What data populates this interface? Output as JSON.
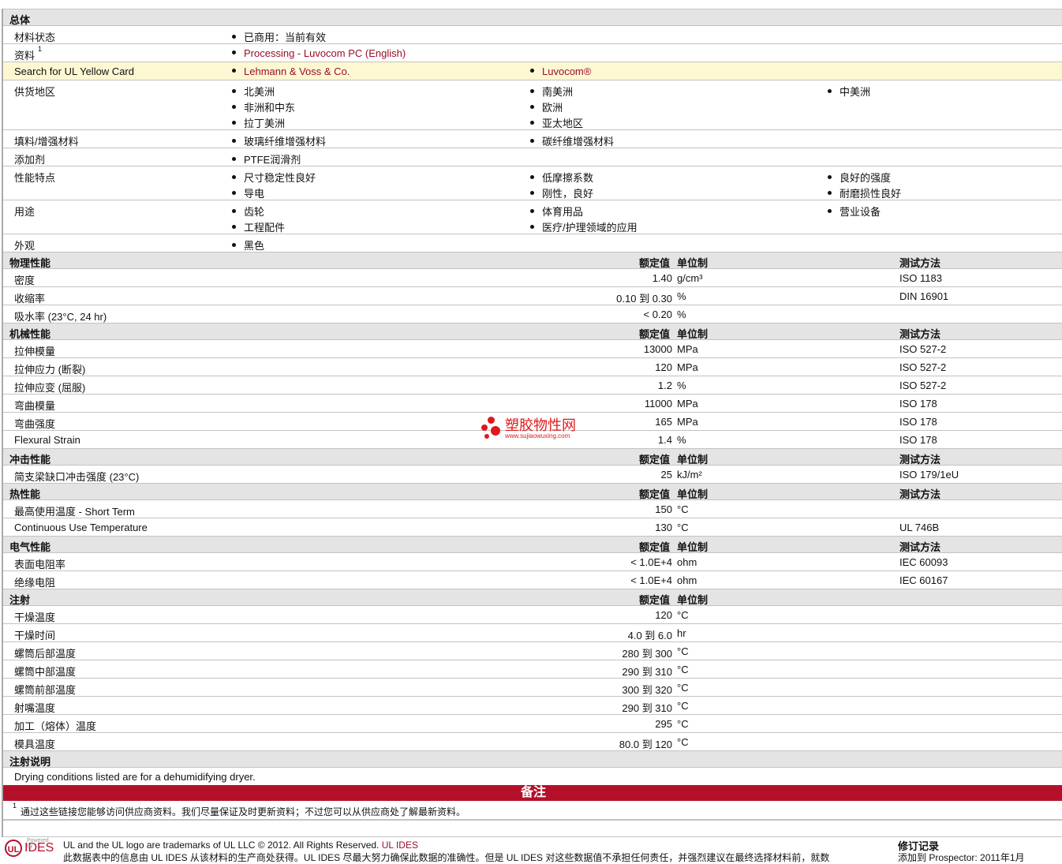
{
  "general": {
    "title": "总体",
    "rows": [
      {
        "label": "材料状态",
        "cols": [
          [
            "已商用：当前有效"
          ]
        ]
      },
      {
        "label": "资料",
        "sup": "1",
        "cols": [
          [
            "Processing - Luvocom PC (English)"
          ]
        ],
        "link": true
      },
      {
        "label": "Search for UL Yellow Card",
        "cols": [
          [
            "Lehmann & Voss & Co."
          ],
          [
            "Luvocom®"
          ]
        ],
        "link": true,
        "yellow": true
      },
      {
        "label": "供货地区",
        "cols": [
          [
            "北美洲",
            "非洲和中东",
            "拉丁美洲"
          ],
          [
            "南美洲",
            "欧洲",
            "亚太地区"
          ],
          [
            "中美洲"
          ]
        ]
      },
      {
        "label": "填料/增强材料",
        "cols": [
          [
            "玻璃纤维增强材料"
          ],
          [
            "碳纤维增强材料"
          ]
        ]
      },
      {
        "label": "添加剂",
        "cols": [
          [
            "PTFE润滑剂"
          ]
        ]
      },
      {
        "label": "性能特点",
        "cols": [
          [
            "尺寸稳定性良好",
            "导电"
          ],
          [
            "低摩擦系数",
            "刚性，良好"
          ],
          [
            "良好的强度",
            "耐磨损性良好"
          ]
        ]
      },
      {
        "label": "用途",
        "cols": [
          [
            "齿轮",
            "工程配件"
          ],
          [
            "体育用品",
            "医疗/护理领域的应用"
          ],
          [
            "营业设备"
          ]
        ]
      },
      {
        "label": "外观",
        "cols": [
          [
            "黑色"
          ]
        ]
      }
    ]
  },
  "headers": {
    "value": "额定值",
    "unit": "单位制",
    "method": "测试方法"
  },
  "sections": [
    {
      "title": "物理性能",
      "method": true,
      "rows": [
        [
          "密度",
          "1.40",
          "g/cm³",
          "ISO 1183"
        ],
        [
          "收缩率",
          "0.10 到  0.30",
          "%",
          "DIN 16901"
        ],
        [
          "吸水率  (23°C, 24 hr)",
          "< 0.20",
          "%",
          ""
        ]
      ]
    },
    {
      "title": "机械性能",
      "method": true,
      "rows": [
        [
          "拉伸模量",
          "13000",
          "MPa",
          "ISO 527-2"
        ],
        [
          "拉伸应力  (断裂)",
          "120",
          "MPa",
          "ISO 527-2"
        ],
        [
          "拉伸应变  (屈服)",
          "1.2",
          "%",
          "ISO 527-2"
        ],
        [
          "弯曲模量",
          "11000",
          "MPa",
          "ISO 178"
        ],
        [
          "弯曲强度",
          "165",
          "MPa",
          "ISO 178"
        ],
        [
          "Flexural Strain",
          "1.4",
          "%",
          "ISO 178"
        ]
      ]
    },
    {
      "title": "冲击性能",
      "method": true,
      "rows": [
        [
          "简支梁缺口冲击强度  (23°C)",
          "25",
          "kJ/m²",
          "ISO 179/1eU"
        ]
      ]
    },
    {
      "title": "热性能",
      "method": true,
      "rows": [
        [
          "最高使用温度  - Short Term",
          "150",
          "°C",
          ""
        ],
        [
          "Continuous Use Temperature",
          "130",
          "°C",
          "UL 746B"
        ]
      ]
    },
    {
      "title": "电气性能",
      "method": true,
      "rows": [
        [
          "表面电阻率",
          "< 1.0E+4",
          "ohm",
          "IEC 60093"
        ],
        [
          "绝缘电阻",
          "< 1.0E+4",
          "ohm",
          "IEC 60167"
        ]
      ]
    },
    {
      "title": "注射",
      "method": false,
      "rows": [
        [
          "干燥温度",
          "120",
          "°C",
          ""
        ],
        [
          "干燥时间",
          "4.0 到  6.0",
          "hr",
          ""
        ],
        [
          "螺筒后部温度",
          "280 到  300",
          "°C",
          ""
        ],
        [
          "螺筒中部温度",
          "290 到  310",
          "°C",
          ""
        ],
        [
          "螺筒前部温度",
          "300 到  320",
          "°C",
          ""
        ],
        [
          "射嘴温度",
          "290 到  310",
          "°C",
          ""
        ],
        [
          "加工（熔体）温度",
          "295",
          "°C",
          ""
        ],
        [
          "模具温度",
          "80.0 到  120",
          "°C",
          ""
        ]
      ]
    }
  ],
  "injection_notes": {
    "title": "注射说明",
    "text": "Drying conditions listed are for a dehumidifying dryer."
  },
  "notes": {
    "title": "备注",
    "sup": "1",
    "text": "通过这些链接您能够访问供应商资料。我们尽量保证及时更新资料；不过您可以从供应商处了解最新资料。"
  },
  "watermark": {
    "name": "塑胶物性网",
    "url": "www.sujiaowuxing.com"
  },
  "footer": {
    "powered": "Powered by",
    "logo_ul": "UL",
    "logo_ides": "IDES",
    "line1": "UL and the UL logo are trademarks of UL LLC © 2012. All Rights Reserved.",
    "line1_link": "UL IDES",
    "line2": "此数据表中的信息由 UL IDES 从该材料的生产商处获得。UL IDES 尽最大努力确保此数据的准确性。但是 UL IDES 对这些数据值不承担任何责任，并强烈建议在最终选择材料前，就数",
    "rev_title": "修订记录",
    "rev_text": "添加到 Prospector:  2011年1月"
  }
}
